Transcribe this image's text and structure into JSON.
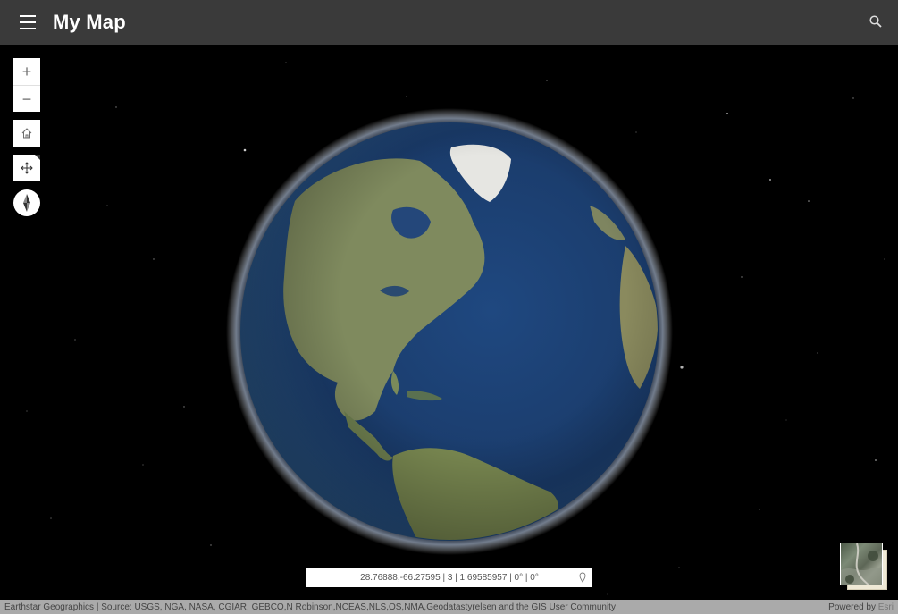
{
  "header": {
    "title": "My Map",
    "menu_icon": "hamburger-menu-icon",
    "search_icon": "search-icon"
  },
  "controls": {
    "zoom_in_label": "+",
    "zoom_out_label": "−",
    "home_icon": "home-icon",
    "navigation_icon": "pan-arrows-icon",
    "compass_icon": "compass-icon"
  },
  "coordinates": {
    "text": "28.76888,-66.27595 | 3 | 1:69585957 | 0° | 0°"
  },
  "attribution": {
    "sources": "Earthstar Geographics | Source: USGS, NGA, NASA, CGIAR, GEBCO,N Robinson,NCEAS,NLS,OS,NMA,Geodatastyrelsen and the GIS User Community",
    "powered_by": "Powered by",
    "esri": "Esri"
  },
  "colors": {
    "header_bg": "#3a3a3a",
    "ocean": "#1b3d6e",
    "land": "#7d8a5a",
    "space": "#000000"
  }
}
